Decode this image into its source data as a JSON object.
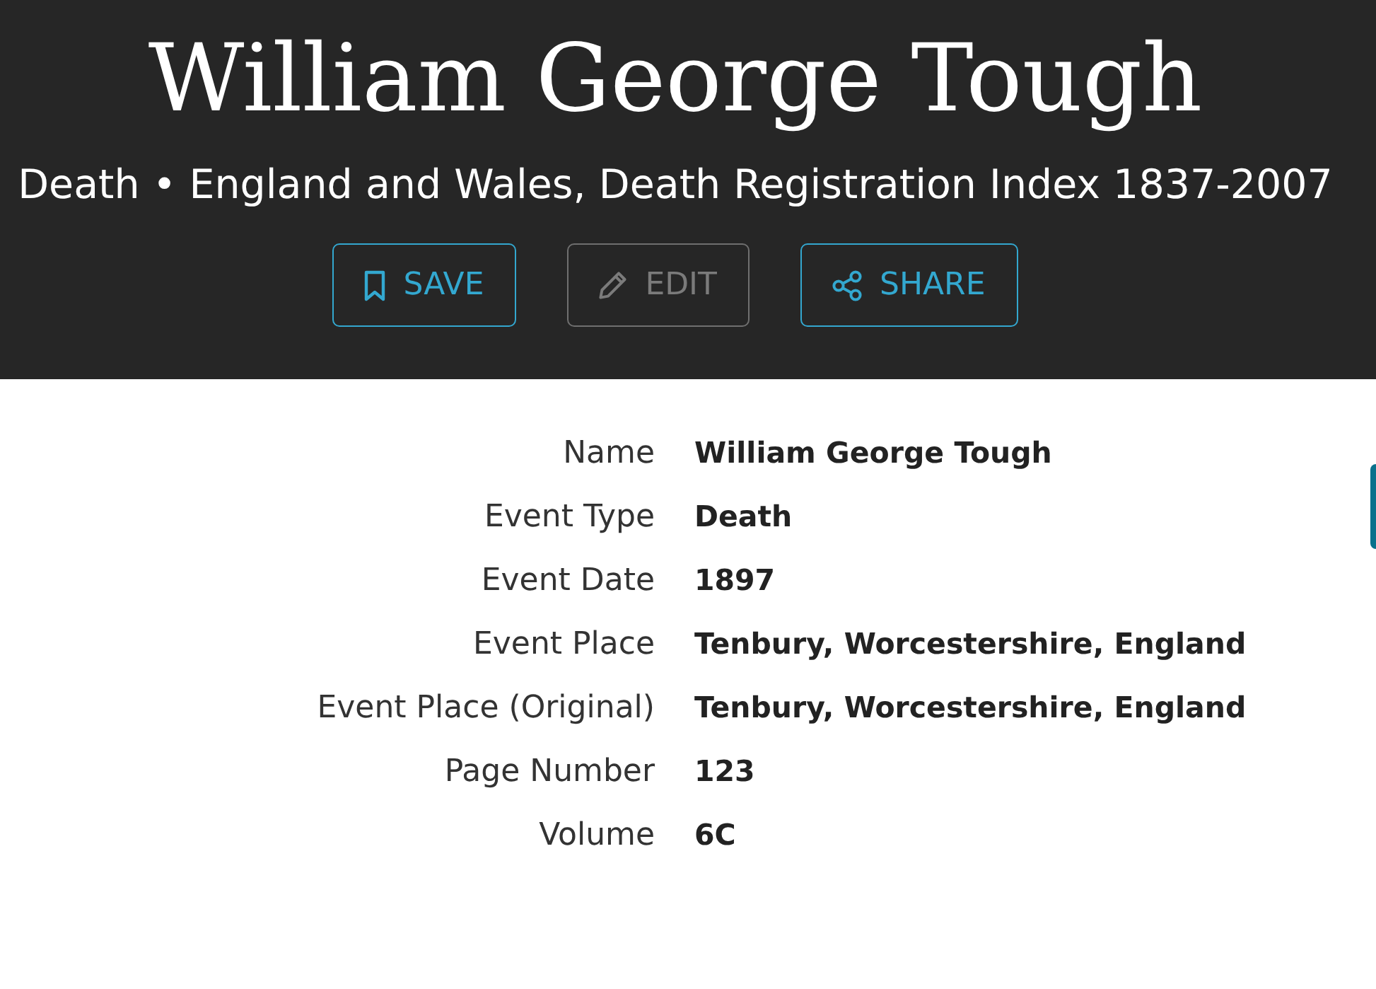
{
  "header": {
    "title": "William George Tough",
    "subtitle": "Death • England and Wales, Death Registration Index 1837-2007",
    "actions": [
      {
        "kind": "save",
        "label": "SAVE",
        "disabled": false
      },
      {
        "kind": "edit",
        "label": "EDIT",
        "disabled": true
      },
      {
        "kind": "share",
        "label": "SHARE",
        "disabled": false
      }
    ]
  },
  "details": [
    {
      "label": "Name",
      "value": "William George Tough"
    },
    {
      "label": "Event Type",
      "value": "Death"
    },
    {
      "label": "Event Date",
      "value": "1897"
    },
    {
      "label": "Event Place",
      "value": "Tenbury, Worcestershire, England"
    },
    {
      "label": "Event Place (Original)",
      "value": "Tenbury, Worcestershire, England"
    },
    {
      "label": "Page Number",
      "value": "123"
    },
    {
      "label": "Volume",
      "value": "6C"
    }
  ]
}
